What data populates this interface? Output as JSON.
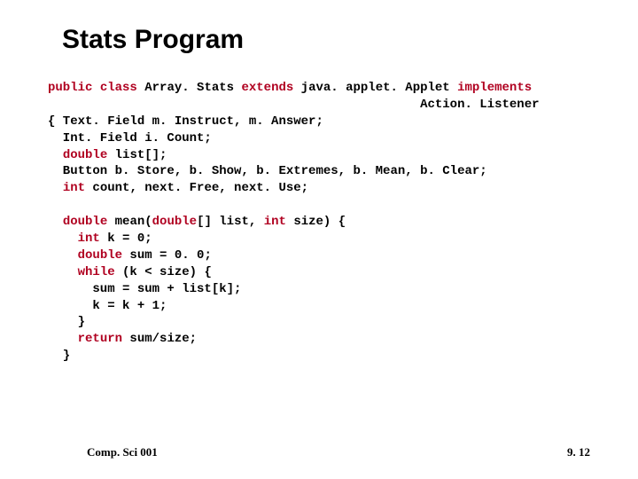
{
  "title": "Stats Program",
  "code": {
    "l1a": "public",
    "l1b": " ",
    "l1c": "class",
    "l1d": " Array. Stats ",
    "l1e": "extends",
    "l1f": " java. applet. Applet ",
    "l1g": "implements",
    "l2a": "                                                  Action. Listener",
    "l3a": "{ Text. Field m. Instruct, m. Answer;",
    "l4a": "  Int. Field i. Count;",
    "l5a": "  ",
    "l5b": "double",
    "l5c": " list[];",
    "l6a": "  Button b. Store, b. Show, b. Extremes, b. Mean, b. Clear;",
    "l7a": "  ",
    "l7b": "int",
    "l7c": " count, next. Free, next. Use;",
    "blank1": "",
    "l8a": "  ",
    "l8b": "double",
    "l8c": " mean(",
    "l8d": "double",
    "l8e": "[] list, ",
    "l8f": "int",
    "l8g": " size) {",
    "l9a": "    ",
    "l9b": "int",
    "l9c": " k = 0;",
    "l10a": "    ",
    "l10b": "double",
    "l10c": " sum = 0. 0;",
    "l11a": "    ",
    "l11b": "while",
    "l11c": " (k < size) {",
    "l12a": "      sum = sum + list[k];",
    "l13a": "      k = k + 1;",
    "l14a": "    }",
    "l15a": "    ",
    "l15b": "return",
    "l15c": " sum/size;",
    "l16a": "  }"
  },
  "footer": {
    "left": "Comp. Sci 001",
    "right": "9. 12"
  }
}
